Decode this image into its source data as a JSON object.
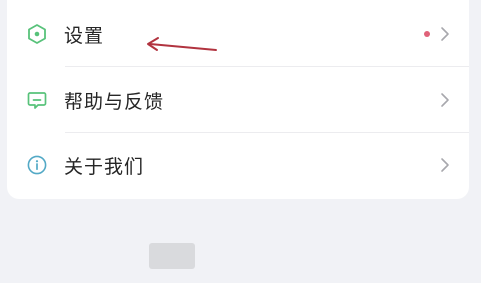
{
  "menu": {
    "items": [
      {
        "label": "设置",
        "icon": "hexagon-settings-icon",
        "has_badge_dot": true
      },
      {
        "label": "帮助与反馈",
        "icon": "feedback-chat-icon",
        "has_badge_dot": false
      },
      {
        "label": "关于我们",
        "icon": "info-circle-icon",
        "has_badge_dot": false
      }
    ]
  },
  "colors": {
    "page_bg": "#f1f2f6",
    "card_bg": "#ffffff",
    "icon_green": "#58c27a",
    "icon_info": "#53a9c6",
    "badge_dot": "#e06279",
    "chevron": "#a8a8ad",
    "annotation_arrow": "#b1333f"
  }
}
